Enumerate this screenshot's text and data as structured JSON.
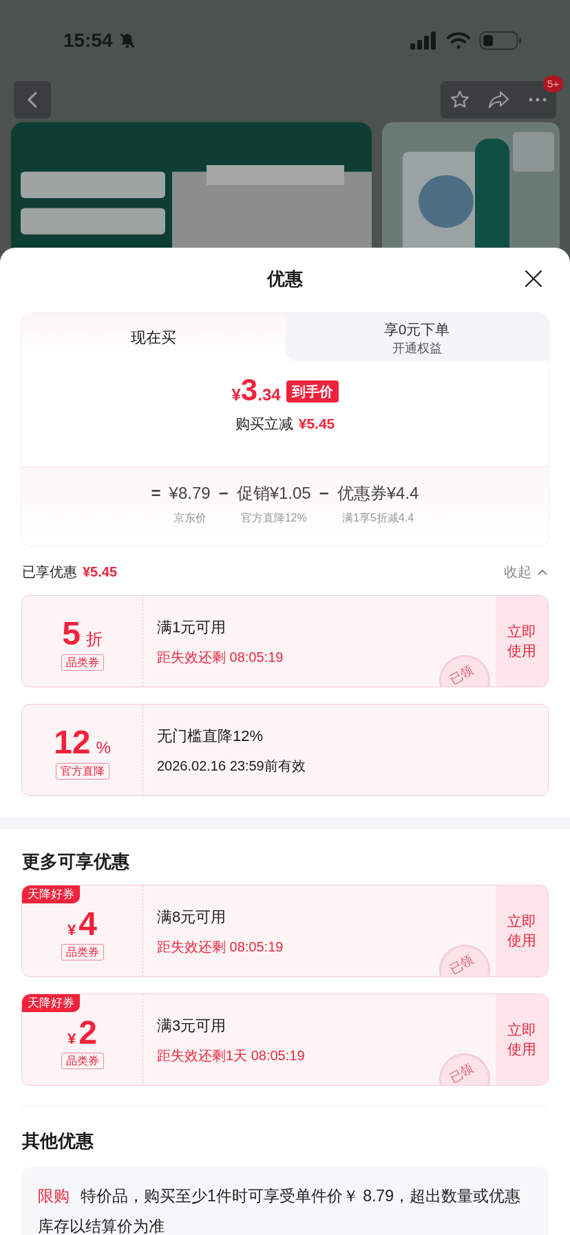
{
  "status_bar": {
    "time": "15:54"
  },
  "nav": {
    "badge": "5+"
  },
  "sheet": {
    "title": "优惠",
    "tabs": [
      {
        "label": "现在买",
        "selected": true
      },
      {
        "label": "享0元下单",
        "sublabel": "开通权益",
        "selected": false
      }
    ],
    "price": {
      "symbol": "¥",
      "integer": "3",
      "decimal": ".34",
      "tag": "到手价"
    },
    "reduction": {
      "label": "购买立减",
      "amount": "¥5.45"
    },
    "breakdown": [
      {
        "operator": "=",
        "amount": "¥8.79",
        "caption": "京东价"
      },
      {
        "operator": "−",
        "amount": "促销¥1.05",
        "caption": "官方直降12%"
      },
      {
        "operator": "−",
        "amount": "优惠券¥4.4",
        "caption": "满1享5折减4.4"
      }
    ],
    "enjoyed": {
      "label": "已享优惠",
      "amount": "¥5.45",
      "toggle": "收起",
      "expanded": true
    },
    "used_coupons": [
      {
        "value": "5",
        "suffix": "折",
        "tag": "品类券",
        "condition": "满1元可用",
        "expiry": "距失效还剩 08:05:19",
        "urgent": true,
        "action": "立即使用",
        "stamp": "已领"
      },
      {
        "value": "12",
        "suffix": "%",
        "tag": "官方直降",
        "condition": "无门槛直降12%",
        "expiry": "2026.02.16 23:59前有效",
        "urgent": false
      }
    ],
    "more": {
      "title": "更多可享优惠",
      "coupons": [
        {
          "ribbon": "天降好券",
          "prefix": "¥",
          "value": "4",
          "tag": "品类券",
          "condition": "满8元可用",
          "expiry": "距失效还剩 08:05:19",
          "urgent": true,
          "action": "立即使用",
          "stamp": "已领"
        },
        {
          "ribbon": "天降好券",
          "prefix": "¥",
          "value": "2",
          "tag": "品类券",
          "condition": "满3元可用",
          "expiry": "距失效还剩1天 08:05:19",
          "urgent": true,
          "action": "立即使用",
          "stamp": "已领"
        }
      ]
    },
    "other": {
      "title": "其他优惠",
      "items": [
        {
          "tag": "限购",
          "text": "特价品，购买至少1件时可享受单件价￥ 8.79，超出数量或优惠库存以结算价为准"
        }
      ]
    }
  }
}
